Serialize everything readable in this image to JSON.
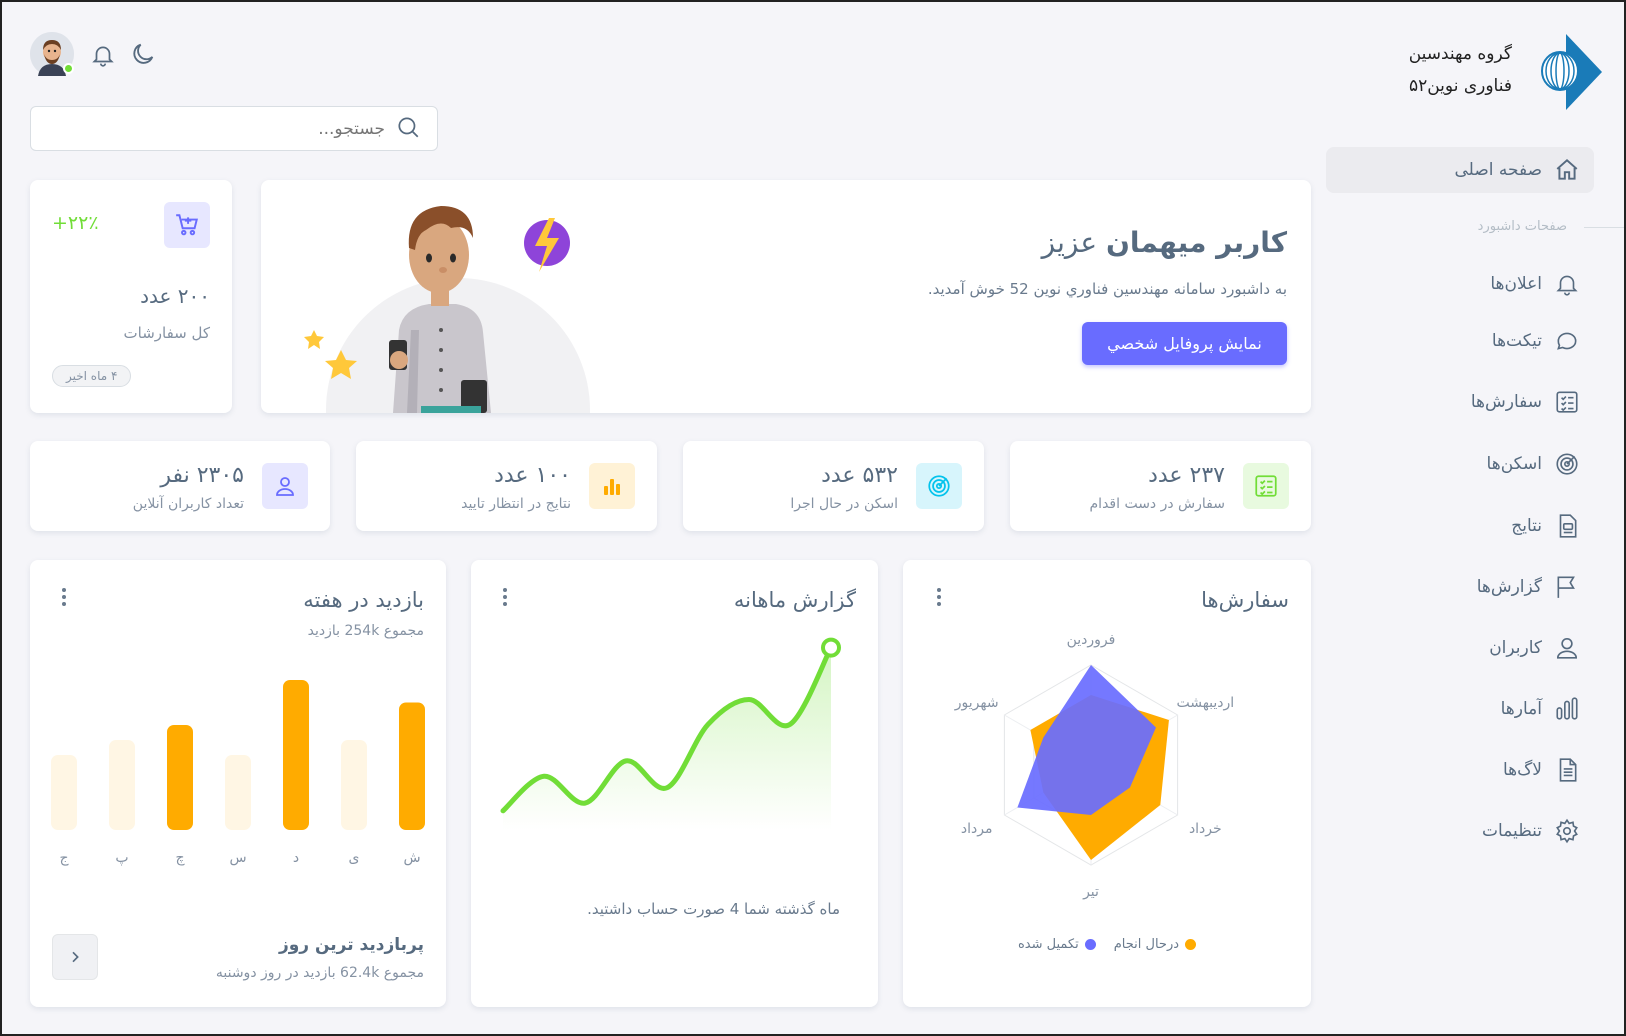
{
  "brand": {
    "line1": "گروه مهندسین",
    "line2": "فناوری نوین۵۲",
    "color": "#1a7bb8"
  },
  "sidebar": {
    "home": "صفحه اصلی",
    "section": "صفحات داشبورد",
    "items": [
      {
        "label": "اعلان‌ها",
        "icon": "bell-icon"
      },
      {
        "label": "تیکت‌ها",
        "icon": "chat-icon"
      },
      {
        "label": "سفارش‌ها",
        "icon": "checklist-icon"
      },
      {
        "label": "اسکن‌ها",
        "icon": "radar-icon"
      },
      {
        "label": "نتایج",
        "icon": "document-icon"
      },
      {
        "label": "گزارش‌ها",
        "icon": "flag-icon"
      },
      {
        "label": "کاربران",
        "icon": "user-icon"
      },
      {
        "label": "آمارها",
        "icon": "chart-icon"
      },
      {
        "label": "لاگ‌ها",
        "icon": "file-icon"
      },
      {
        "label": "تنظیمات",
        "icon": "gear-icon"
      }
    ]
  },
  "search": {
    "placeholder": "جستجو..."
  },
  "welcome": {
    "title_bold": "کاربر میهمان",
    "title_rest": " عزیز",
    "subtitle": "به داشبورد سامانه مهندسین فناوري نوين 52 خوش آمدید.",
    "button": "نمایش پروفایل شخصي"
  },
  "orders_card": {
    "growth": "+۲۲٪",
    "value": "۲۰۰ عدد",
    "label": "کل سفارشات",
    "badge": "۴ ماه اخیر"
  },
  "stats": [
    {
      "value": "۲۳۷ عدد",
      "label": "سفارش در دست اقدام",
      "color": "#71dd37",
      "bg": "#e8fadf"
    },
    {
      "value": "۵۳۲ عدد",
      "label": "اسکن در حال اجرا",
      "color": "#03c3ec",
      "bg": "#d7f5fc"
    },
    {
      "value": "۱۰۰ عدد",
      "label": "نتایج در انتظار تایید",
      "color": "#ffab00",
      "bg": "#fff2d6"
    },
    {
      "value": "۲۳۰۵ نفر",
      "label": "تعداد کاربران آنلاین",
      "color": "#696cff",
      "bg": "#e7e7ff"
    }
  ],
  "weekly": {
    "title": "بازدید در هفته",
    "subtitle": "مجموع 254k بازدید",
    "best_day_title": "پربازدید ترین روز",
    "best_day_sub": "مجموع 62.4k بازدید در روز دوشنبه"
  },
  "monthly": {
    "title": "گزارش ماهانه",
    "note": "ماه گذشته شما 4 صورت حساب داشتید."
  },
  "orders_chart": {
    "title": "سفارش‌ها",
    "legend_done": "تکمیل شده",
    "legend_progress": "درحال انجام"
  },
  "chart_data": [
    {
      "type": "bar",
      "title": "بازدید در هفته",
      "categories": [
        "ش",
        "ی",
        "د",
        "س",
        "چ",
        "پ",
        "ج"
      ],
      "values": [
        85,
        60,
        100,
        50,
        70,
        60,
        50
      ],
      "highlight": [
        true,
        false,
        true,
        false,
        true,
        false,
        false
      ],
      "colors": {
        "highlight": "#ffab00",
        "muted": "#fff6e4"
      }
    },
    {
      "type": "line",
      "title": "گزارش ماهانه",
      "x": [
        0,
        1,
        2,
        3,
        4,
        5,
        6,
        7,
        8
      ],
      "values": [
        10,
        28,
        14,
        36,
        22,
        55,
        68,
        55,
        95
      ],
      "color": "#71dd37"
    },
    {
      "type": "radar",
      "title": "سفارش‌ها",
      "categories": [
        "فروردین",
        "اردیبهشت",
        "خرداد",
        "تیر",
        "مرداد",
        "شهریور"
      ],
      "series": [
        {
          "name": "درحال انجام",
          "values": [
            70,
            90,
            80,
            95,
            55,
            70
          ],
          "color": "#ffab00"
        },
        {
          "name": "تکمیل شده",
          "values": [
            100,
            75,
            45,
            50,
            85,
            55
          ],
          "color": "#696cff"
        }
      ],
      "max": 100
    }
  ]
}
